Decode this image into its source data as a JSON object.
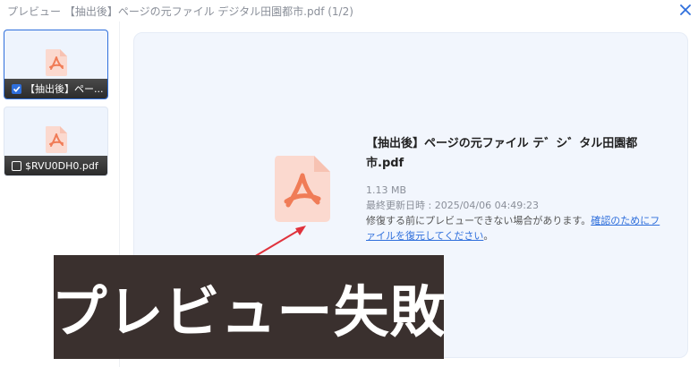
{
  "window": {
    "title": "プレビュー 【抽出後】ページの元ファイル デジタル田園都市.pdf (1/2)",
    "close_icon": "close-icon"
  },
  "sidebar": {
    "items": [
      {
        "label": "【抽出後】ペー...",
        "checked": true,
        "icon": "pdf-file-icon"
      },
      {
        "label": "$RVU0DH0.pdf",
        "checked": false,
        "icon": "pdf-file-icon"
      }
    ]
  },
  "preview": {
    "file_name": "【抽出後】ページの元ファイル テ゛シ゛タル田園都市.pdf",
    "file_size": "1.13 MB",
    "modified": "最終更新日時 : 2025/04/06 04:49:23",
    "warning_text": "修復する前にプレビューできない場合があります。",
    "warning_link": "確認のためにファイルを復元してください",
    "warning_end": "。",
    "icon": "pdf-file-icon"
  },
  "overlay": {
    "banner_text": "プレビュー失敗"
  },
  "colors": {
    "accent": "#2f6fdc",
    "pdf_icon_bg": "#fbd9cf",
    "pdf_icon_fg": "#f07c57",
    "arrow": "#e0323c",
    "banner_bg": "#3a302e"
  }
}
